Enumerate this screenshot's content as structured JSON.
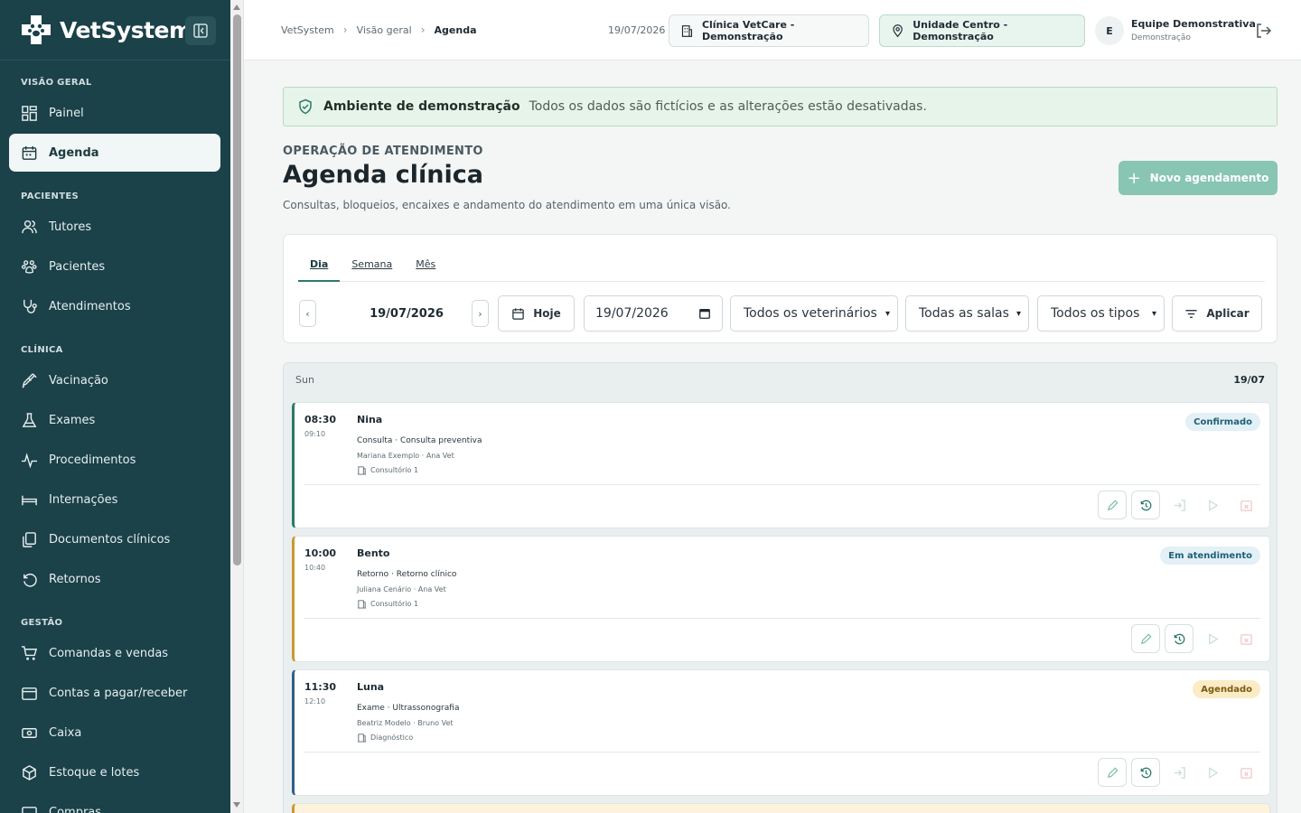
{
  "brand": {
    "name": "VetSystem"
  },
  "sidebar": {
    "sections": [
      {
        "title": "VISÃO GERAL"
      },
      {
        "title": "PACIENTES"
      },
      {
        "title": "CLÍNICA"
      },
      {
        "title": "GESTÃO"
      }
    ],
    "items": [
      {
        "label": "Painel",
        "icon": "dashboard-icon"
      },
      {
        "label": "Agenda",
        "icon": "calendar-icon",
        "active": true
      },
      {
        "label": "Tutores",
        "icon": "users-icon"
      },
      {
        "label": "Pacientes",
        "icon": "paw-icon"
      },
      {
        "label": "Atendimentos",
        "icon": "stethoscope-icon"
      },
      {
        "label": "Vacinação",
        "icon": "syringe-icon"
      },
      {
        "label": "Exames",
        "icon": "flask-icon"
      },
      {
        "label": "Procedimentos",
        "icon": "pulse-icon"
      },
      {
        "label": "Internações",
        "icon": "bed-icon"
      },
      {
        "label": "Documentos clínicos",
        "icon": "documents-icon"
      },
      {
        "label": "Retornos",
        "icon": "return-icon"
      },
      {
        "label": "Comandas e vendas",
        "icon": "cart-icon"
      },
      {
        "label": "Contas a pagar/receber",
        "icon": "wallet-icon"
      },
      {
        "label": "Caixa",
        "icon": "cash-icon"
      },
      {
        "label": "Estoque e lotes",
        "icon": "box-icon"
      },
      {
        "label": "Compras",
        "icon": "purchase-icon"
      }
    ]
  },
  "topbar": {
    "breadcrumbs": [
      "VetSystem",
      "Visão geral",
      "Agenda"
    ],
    "date": "19/07/2026",
    "clinic": "Clínica VetCare - Demonstração",
    "unit": "Unidade Centro - Demonstração",
    "user": {
      "initial": "E",
      "name": "Equipe Demonstrativa",
      "role": "Demonstração"
    }
  },
  "banner": {
    "title": "Ambiente de demonstração",
    "text": "Todos os dados são fictícios e as alterações estão desativadas."
  },
  "header": {
    "eyebrow": "OPERAÇÃO DE ATENDIMENTO",
    "title": "Agenda clínica",
    "subtitle": "Consultas, bloqueios, encaixes e andamento do atendimento em uma única visão.",
    "new_button": "Novo agendamento"
  },
  "filters": {
    "tabs": [
      "Dia",
      "Semana",
      "Mês"
    ],
    "active_tab": "Dia",
    "current_date": "19/07/2026",
    "today_label": "Hoje",
    "date_input": "19/07/2026",
    "vet_select": "Todos os veterinários",
    "room_select": "Todas as salas",
    "type_select": "Todos os tipos",
    "apply_label": "Aplicar"
  },
  "day": {
    "weekday": "Sun",
    "date": "19/07"
  },
  "appointments": [
    {
      "start": "08:30",
      "end": "09:10",
      "pet": "Nina",
      "service": "Consulta · Consulta preventiva",
      "people": "Mariana Exemplo · Ana Vet",
      "room": "Consultório 1",
      "status": "Confirmado",
      "status_color": "#e3f0f6",
      "status_text": "#1f5f78",
      "accent": "#2b7a68"
    },
    {
      "start": "10:00",
      "end": "10:40",
      "pet": "Bento",
      "service": "Retorno · Retorno clínico",
      "people": "Juliana Cenário · Ana Vet",
      "room": "Consultório 1",
      "status": "Em atendimento",
      "status_color": "#e3f0f6",
      "status_text": "#1f5f78",
      "accent": "#c99a2e"
    },
    {
      "start": "11:30",
      "end": "12:10",
      "pet": "Luna",
      "service": "Exame · Ultrassonografia",
      "people": "Beatriz Modelo · Bruno Vet",
      "room": "Diagnóstico",
      "status": "Agendado",
      "status_color": "#fbecc6",
      "status_text": "#7a5a10",
      "accent": "#2f5f8a"
    }
  ]
}
